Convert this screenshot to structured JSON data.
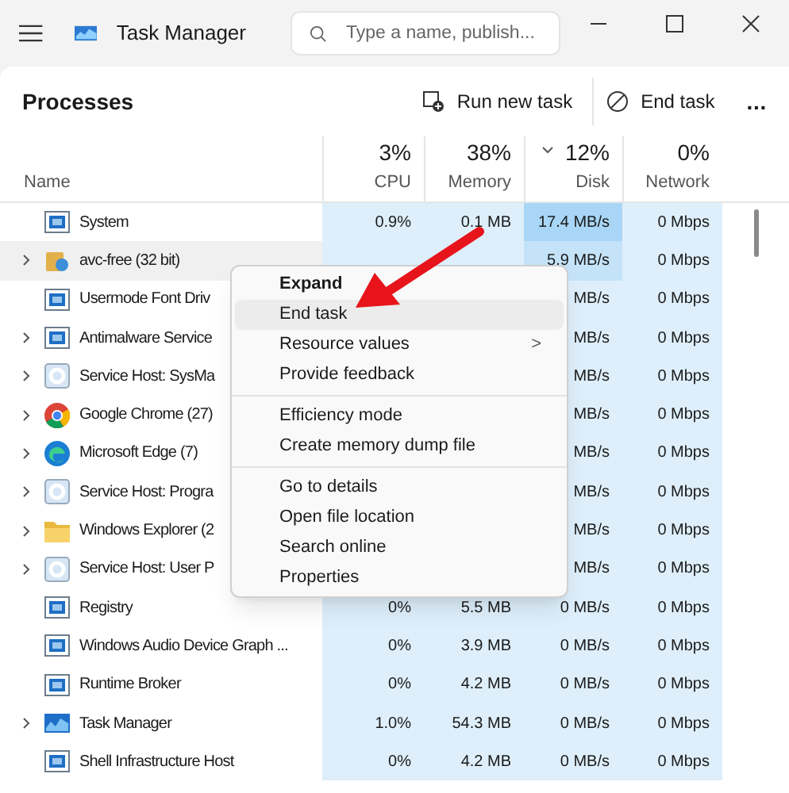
{
  "window": {
    "title": "Task Manager"
  },
  "search": {
    "placeholder": "Type a name, publish..."
  },
  "page_title": "Processes",
  "toolbar": [
    {
      "kind": "run",
      "label": "Run new task"
    },
    {
      "kind": "end",
      "label": "End task"
    },
    {
      "kind": "more",
      "label": "..."
    }
  ],
  "columns": [
    {
      "name": "Name",
      "sorted": false
    },
    {
      "name": "CPU",
      "percent": "3%",
      "sorted": false
    },
    {
      "name": "Memory",
      "percent": "38%",
      "sorted": false
    },
    {
      "name": "Disk",
      "percent": "12%",
      "sorted": true
    },
    {
      "name": "Network",
      "percent": "0%",
      "sorted": false
    }
  ],
  "rows": [
    {
      "name": "System",
      "kind": "app",
      "expandable": false,
      "selected": false,
      "disk_high": true,
      "cpu": "0.9%",
      "memory": "0.1 MB",
      "disk": "17.4 MB/s",
      "network": "0 Mbps"
    },
    {
      "name": "avc-free (32 bit)",
      "kind": "avc",
      "expandable": true,
      "selected": true,
      "disk_high": true,
      "disk": "5.9 MB/s",
      "network": "0 Mbps"
    },
    {
      "name": "Usermode Font Driv",
      "kind": "app",
      "expandable": false,
      "selected": false,
      "disk_high": false,
      "disk": "MB/s",
      "network": "0 Mbps"
    },
    {
      "name": "Antimalware Service",
      "kind": "app",
      "expandable": true,
      "selected": false,
      "disk_high": false,
      "disk": "MB/s",
      "network": "0 Mbps"
    },
    {
      "name": "Service Host: SysMa",
      "kind": "gear",
      "expandable": true,
      "selected": false,
      "disk_high": false,
      "disk": "MB/s",
      "network": "0 Mbps"
    },
    {
      "name": "Google Chrome (27)",
      "kind": "chrome",
      "expandable": true,
      "selected": false,
      "disk_high": false,
      "disk": "MB/s",
      "network": "0 Mbps"
    },
    {
      "name": "Microsoft Edge (7)",
      "kind": "edge",
      "expandable": true,
      "selected": false,
      "disk_high": false,
      "disk": "MB/s",
      "network": "0 Mbps"
    },
    {
      "name": "Service Host: Progra",
      "kind": "gear",
      "expandable": true,
      "selected": false,
      "disk_high": false,
      "disk": "MB/s",
      "network": "0 Mbps"
    },
    {
      "name": "Windows Explorer (2",
      "kind": "folder",
      "expandable": true,
      "selected": false,
      "disk_high": false,
      "disk": "MB/s",
      "network": "0 Mbps"
    },
    {
      "name": "Service Host: User P",
      "kind": "gear",
      "expandable": true,
      "selected": false,
      "disk_high": false,
      "disk": "MB/s",
      "network": "0 Mbps"
    },
    {
      "name": "Registry",
      "kind": "app",
      "expandable": false,
      "selected": false,
      "disk_high": false,
      "cpu": "0%",
      "memory": "5.5 MB",
      "disk": "0 MB/s",
      "network": "0 Mbps"
    },
    {
      "name": "Windows Audio Device Graph ...",
      "kind": "app",
      "expandable": false,
      "selected": false,
      "disk_high": false,
      "cpu": "0%",
      "memory": "3.9 MB",
      "disk": "0 MB/s",
      "network": "0 Mbps"
    },
    {
      "name": "Runtime Broker",
      "kind": "app",
      "expandable": false,
      "selected": false,
      "disk_high": false,
      "cpu": "0%",
      "memory": "4.2 MB",
      "disk": "0 MB/s",
      "network": "0 Mbps"
    },
    {
      "name": "Task Manager",
      "kind": "tm",
      "expandable": true,
      "selected": false,
      "disk_high": false,
      "cpu": "1.0%",
      "memory": "54.3 MB",
      "disk": "0 MB/s",
      "network": "0 Mbps"
    },
    {
      "name": "Shell Infrastructure Host",
      "kind": "app",
      "expandable": false,
      "selected": false,
      "disk_high": false,
      "cpu": "0%",
      "memory": "4.2 MB",
      "disk": "0 MB/s",
      "network": "0 Mbps"
    }
  ],
  "context_menu": {
    "groups": [
      [
        {
          "label": "Expand",
          "kind": "bold",
          "hovered": false
        },
        {
          "label": "End task",
          "kind": "plain",
          "hovered": true
        },
        {
          "label": "Resource values",
          "kind": "submenu",
          "submenu_glyph": ">",
          "hovered": false
        },
        {
          "label": "Provide feedback",
          "kind": "plain",
          "hovered": false
        }
      ],
      [
        {
          "label": "Efficiency mode",
          "kind": "plain",
          "hovered": false
        },
        {
          "label": "Create memory dump file",
          "kind": "plain",
          "hovered": false
        }
      ],
      [
        {
          "label": "Go to details",
          "kind": "plain",
          "hovered": false
        },
        {
          "label": "Open file location",
          "kind": "plain",
          "hovered": false
        },
        {
          "label": "Search online",
          "kind": "plain",
          "hovered": false
        },
        {
          "label": "Properties",
          "kind": "plain",
          "hovered": false
        }
      ]
    ]
  }
}
